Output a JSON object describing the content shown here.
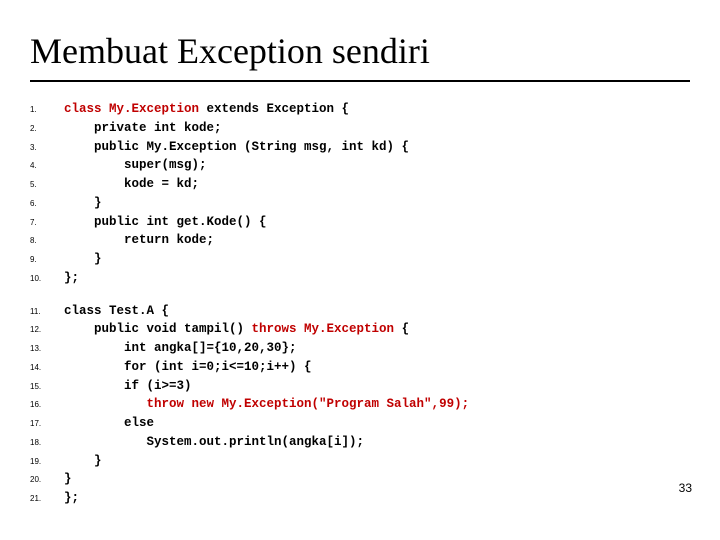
{
  "title": "Membuat Exception sendiri",
  "page_number": "33",
  "code": {
    "block1": [
      {
        "n": "1.",
        "segs": [
          {
            "t": "class My.Exception ",
            "c": "red"
          },
          {
            "t": "extends Exception {"
          }
        ]
      },
      {
        "n": "2.",
        "segs": [
          {
            "t": "    private int kode;"
          }
        ]
      },
      {
        "n": "3.",
        "segs": [
          {
            "t": "    public My.Exception (String msg, int kd) {"
          }
        ]
      },
      {
        "n": "4.",
        "segs": [
          {
            "t": "        super(msg);"
          }
        ]
      },
      {
        "n": "5.",
        "segs": [
          {
            "t": "        kode = kd;"
          }
        ]
      },
      {
        "n": "6.",
        "segs": [
          {
            "t": "    }"
          }
        ]
      },
      {
        "n": "7.",
        "segs": [
          {
            "t": "    public int get.Kode() {"
          }
        ]
      },
      {
        "n": "8.",
        "segs": [
          {
            "t": "        return kode;"
          }
        ]
      },
      {
        "n": "9.",
        "segs": [
          {
            "t": "    }"
          }
        ]
      },
      {
        "n": "10.",
        "segs": [
          {
            "t": "};"
          }
        ]
      }
    ],
    "block2": [
      {
        "n": "11.",
        "segs": [
          {
            "t": "class Test.A {"
          }
        ]
      },
      {
        "n": "12.",
        "segs": [
          {
            "t": "    public void tampil() "
          },
          {
            "t": "throws My.Exception",
            "c": "red"
          },
          {
            "t": " {"
          }
        ]
      },
      {
        "n": "13.",
        "segs": [
          {
            "t": "        int angka[]={10,20,30};"
          }
        ]
      },
      {
        "n": "14.",
        "segs": [
          {
            "t": "        for (int i=0;i<=10;i++) {"
          }
        ]
      },
      {
        "n": "15.",
        "segs": [
          {
            "t": "        if (i>=3)"
          }
        ]
      },
      {
        "n": "16.",
        "segs": [
          {
            "t": "           "
          },
          {
            "t": "throw new My.Exception(\"Program Salah\",99);",
            "c": "red"
          }
        ]
      },
      {
        "n": "17.",
        "segs": [
          {
            "t": "        else"
          }
        ]
      },
      {
        "n": "18.",
        "segs": [
          {
            "t": "           System.out.println(angka[i]);"
          }
        ]
      },
      {
        "n": "19.",
        "segs": [
          {
            "t": "    }"
          }
        ]
      },
      {
        "n": "20.",
        "segs": [
          {
            "t": "}"
          }
        ]
      },
      {
        "n": "21.",
        "segs": [
          {
            "t": "};"
          }
        ]
      }
    ]
  }
}
